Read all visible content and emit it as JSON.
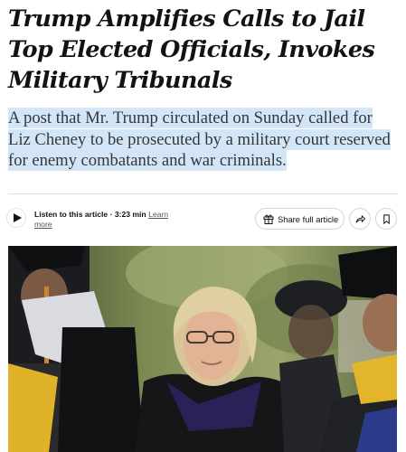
{
  "article": {
    "headline": "Trump Amplifies Calls to Jail Top Elected Officials, Invokes Military Tribunals",
    "summary": "A post that Mr. Trump circulated on Sunday called for Liz Cheney to be prosecuted by a military court reserved for enemy combatants and war criminals."
  },
  "toolbar": {
    "listen_label": "Listen to this article · 3:23 min",
    "learn_more": "Learn more",
    "share_label": "Share full article",
    "play_icon": "play-icon",
    "gift_icon": "gift-icon",
    "share_icon": "share-arrow-icon",
    "bookmark_icon": "bookmark-icon"
  },
  "colors": {
    "highlight": "#d3e6f8",
    "text": "#121212",
    "summary_text": "#363636",
    "border": "#d5d5d5"
  },
  "photo": {
    "subject": "photo"
  }
}
